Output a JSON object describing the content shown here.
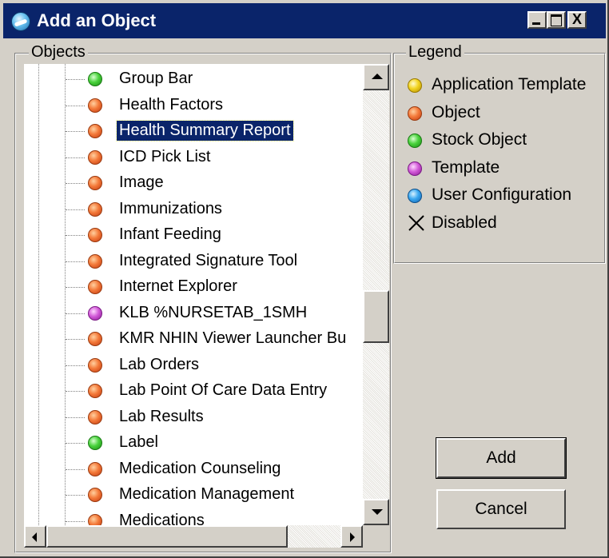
{
  "window": {
    "title": "Add an Object",
    "icon": "app-globe-icon"
  },
  "titlebar_buttons": [
    {
      "name": "minimize",
      "icon": "minimize-icon"
    },
    {
      "name": "maximize",
      "icon": "maximize-icon"
    },
    {
      "name": "close",
      "icon": "close-icon",
      "glyph": "X"
    }
  ],
  "objects_panel": {
    "label": "Objects",
    "items": [
      {
        "label": "Group Bar",
        "kind": "stock"
      },
      {
        "label": "Health Factors",
        "kind": "object"
      },
      {
        "label": "Health Summary Report",
        "kind": "object",
        "selected": true
      },
      {
        "label": "ICD Pick List",
        "kind": "object"
      },
      {
        "label": "Image",
        "kind": "object"
      },
      {
        "label": "Immunizations",
        "kind": "object"
      },
      {
        "label": "Infant Feeding",
        "kind": "object"
      },
      {
        "label": "Integrated Signature Tool",
        "kind": "object"
      },
      {
        "label": "Internet Explorer",
        "kind": "object"
      },
      {
        "label": "KLB %NURSETAB_1SMH",
        "kind": "template"
      },
      {
        "label": "KMR NHIN Viewer Launcher Bu",
        "kind": "object"
      },
      {
        "label": "Lab Orders",
        "kind": "object"
      },
      {
        "label": "Lab Point Of Care Data Entry",
        "kind": "object"
      },
      {
        "label": "Lab Results",
        "kind": "object"
      },
      {
        "label": "Label",
        "kind": "stock"
      },
      {
        "label": "Medication Counseling",
        "kind": "object"
      },
      {
        "label": "Medication Management",
        "kind": "object"
      },
      {
        "label": "Medications",
        "kind": "object"
      }
    ]
  },
  "legend": {
    "label": "Legend",
    "items": [
      {
        "label": "Application Template",
        "kind": "app-template",
        "icon": "yellow-dot-icon"
      },
      {
        "label": "Object",
        "kind": "object",
        "icon": "orange-dot-icon"
      },
      {
        "label": "Stock Object",
        "kind": "stock",
        "icon": "green-dot-icon"
      },
      {
        "label": "Template",
        "kind": "template",
        "icon": "purple-dot-icon"
      },
      {
        "label": "User Configuration",
        "kind": "user-config",
        "icon": "blue-dot-icon"
      },
      {
        "label": "Disabled",
        "kind": "disabled",
        "icon": "disabled-x-icon"
      }
    ]
  },
  "buttons": {
    "add": "Add",
    "cancel": "Cancel"
  },
  "colors": {
    "title_bar": "#0a246a",
    "selection": "#0a246a",
    "dialog_bg": "#d4d0c8"
  }
}
